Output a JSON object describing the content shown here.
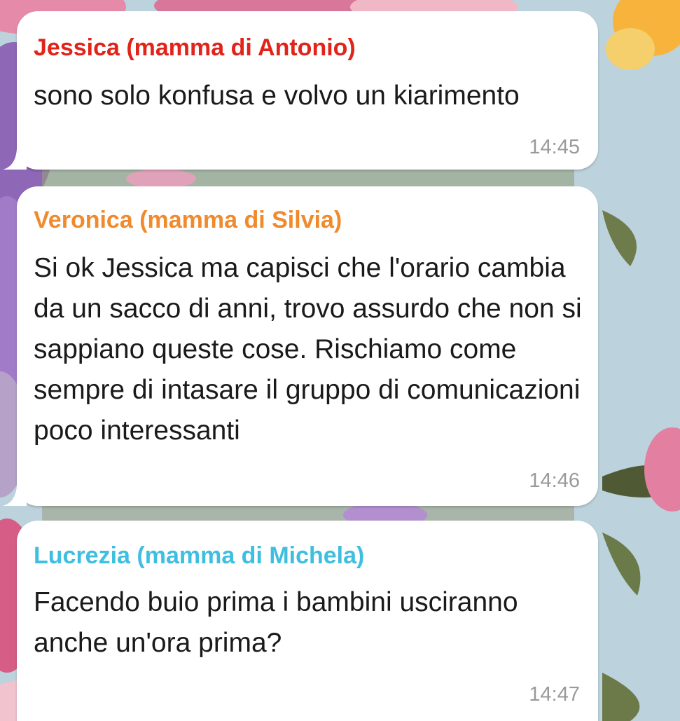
{
  "wallpaper": {
    "description_icon": "floral-wallpaper",
    "base_color": "#b9cfd9"
  },
  "messages": [
    {
      "sender": "Jessica (mamma di Antonio)",
      "sender_color": "#e2231a",
      "text": "sono solo konfusa e volvo un kiarimento",
      "time": "14:45"
    },
    {
      "sender": "Veronica (mamma di Silvia)",
      "sender_color": "#f08a2c",
      "text": "Si ok Jessica ma capisci che l'orario cambia da un sacco di anni, trovo assurdo che non si sappiano queste cose. Rischiamo come sempre di intasare il gruppo di comunicazioni poco interessanti",
      "time": "14:46"
    },
    {
      "sender": "Lucrezia (mamma di Michela)",
      "sender_color": "#3fbfe0",
      "text": "Facendo buio prima i bambini usciranno anche un'ora prima?",
      "time": "14:47"
    }
  ]
}
